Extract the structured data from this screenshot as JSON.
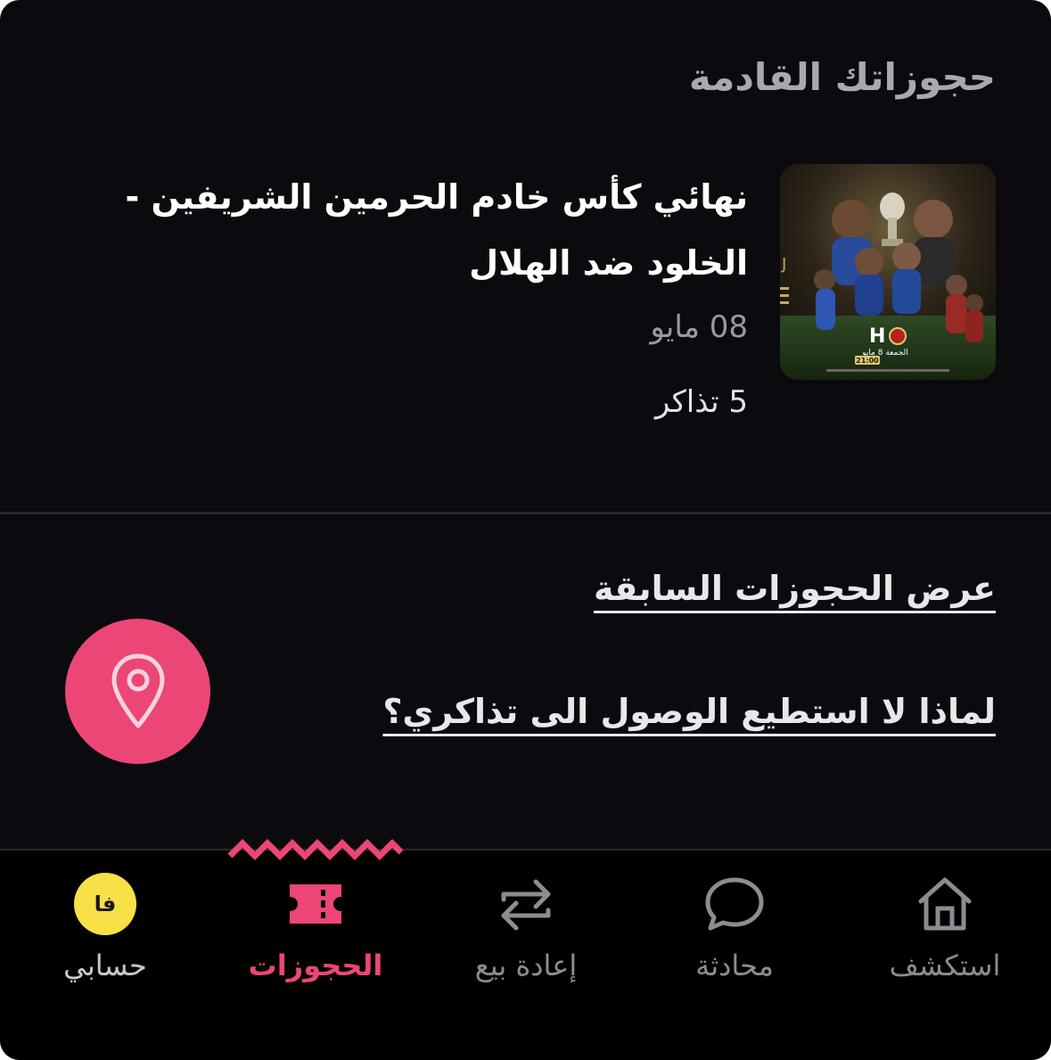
{
  "page": {
    "section_title": "حجوزاتك القادمة"
  },
  "booking": {
    "title": "نهائي كأس خادم الحرمين الشريفين - الخلود ضد الهلال",
    "date": "08 مايو",
    "tickets": "5 تذاكر",
    "poster": {
      "time": "21:00",
      "day": "الجمعة 8 مايو"
    }
  },
  "links": {
    "past_bookings": "عرض الحجوزات السابقة",
    "cant_access": "لماذا لا استطيع الوصول الى تذاكري؟"
  },
  "nav": {
    "items": [
      {
        "label": "استكشف",
        "icon": "home-icon"
      },
      {
        "label": "محادثة",
        "icon": "chat-icon"
      },
      {
        "label": "إعادة بيع",
        "icon": "resale-icon"
      },
      {
        "label": "الحجوزات",
        "icon": "ticket-icon",
        "active": true
      },
      {
        "label": "حسابي",
        "icon": "avatar",
        "initials": "فا"
      }
    ]
  },
  "colors": {
    "accent": "#ec4676",
    "avatar": "#f8e047",
    "background": "#0b0a0e"
  }
}
